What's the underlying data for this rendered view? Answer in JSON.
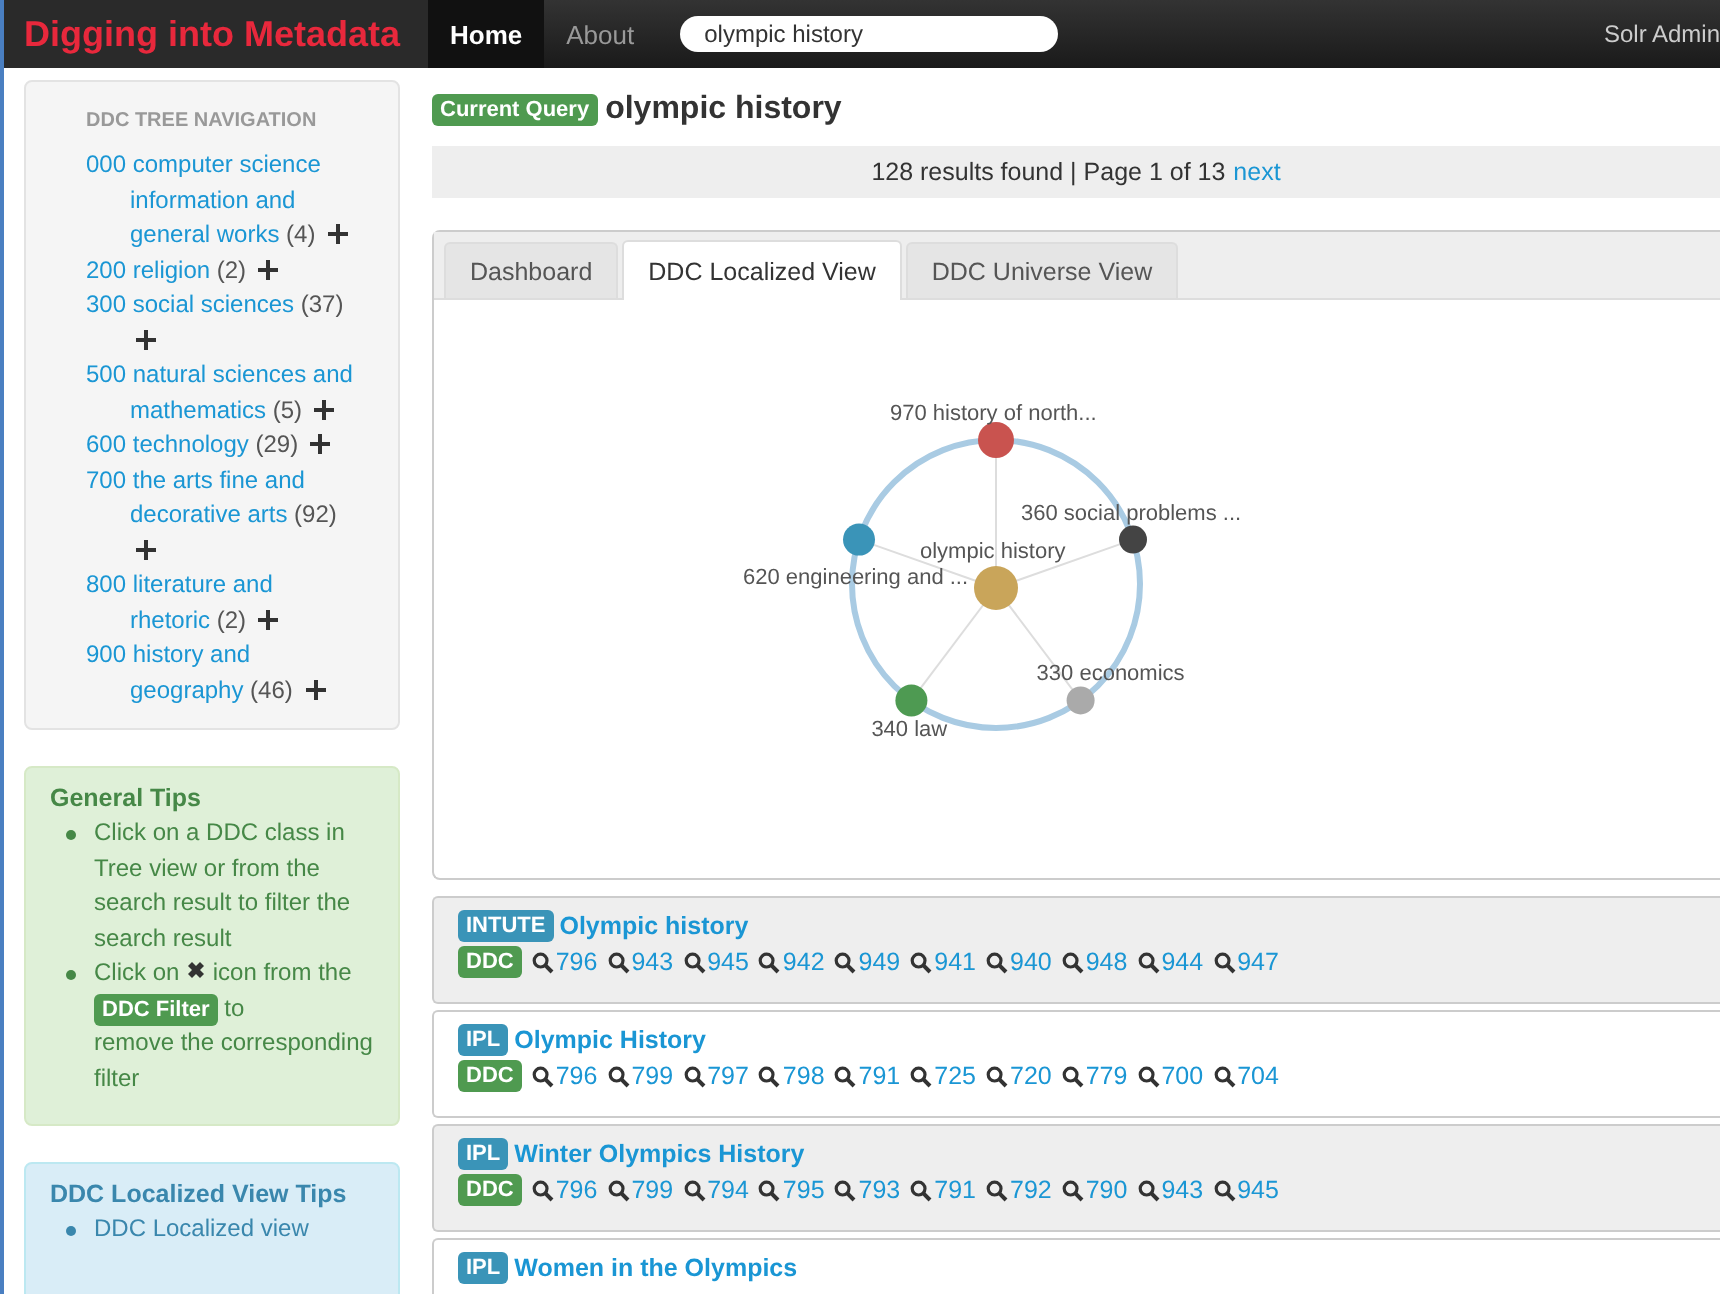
{
  "navbar": {
    "brand": "Digging into Metadata",
    "links": [
      {
        "label": "Home",
        "selected": true
      },
      {
        "label": "About",
        "selected": false
      }
    ],
    "search": {
      "value": "olympic history"
    },
    "admin": "Solr Admin"
  },
  "sidebar": {
    "tree": {
      "heading": "DDC TREE NAVIGATION",
      "items": [
        {
          "label": "000 computer science information and general works",
          "count": "(4)"
        },
        {
          "label": "200 religion",
          "count": "(2)"
        },
        {
          "label": "300 social sciences",
          "count": "(37)"
        },
        {
          "label": "500 natural sciences and mathematics",
          "count": "(5)"
        },
        {
          "label": "600 technology",
          "count": "(29)"
        },
        {
          "label": "700 the arts fine and decorative arts",
          "count": "(92)"
        },
        {
          "label": "800 literature and rhetoric",
          "count": "(2)"
        },
        {
          "label": "900 history and geography",
          "count": "(46)"
        }
      ]
    },
    "general_tips": {
      "title": "General Tips",
      "items": [
        {
          "kind": "text",
          "text": "Click on a DDC class in Tree view or from the search result to filter the search result"
        },
        {
          "kind": "filter",
          "before": "Click on",
          "after_icon": "icon from",
          "between": "the",
          "badge": "DDC Filter",
          "after_badge": "to",
          "tail": "remove the corresponding filter"
        }
      ]
    },
    "localized_tips": {
      "title": "DDC Localized View Tips",
      "items": [
        {
          "kind": "text",
          "text": "DDC Localized view"
        }
      ]
    }
  },
  "query": {
    "badge": "Current Query",
    "text": "olympic history"
  },
  "results_bar": {
    "summary": "128 results found | Page 1 of 13",
    "next": "next"
  },
  "tabs": [
    {
      "label": "Dashboard",
      "selected": false
    },
    {
      "label": "DDC Localized View",
      "selected": true
    },
    {
      "label": "DDC Universe View",
      "selected": false
    }
  ],
  "graph": {
    "center": {
      "label": "olympic history",
      "color": "#c9a55a"
    },
    "nodes": [
      {
        "label": "970 history of north...",
        "color": "#c9534f"
      },
      {
        "label": "360 social problems ...",
        "color": "#444444"
      },
      {
        "label": "620 engineering and ...",
        "color": "#3a94b8"
      },
      {
        "label": "330 economics",
        "color": "#aaaaaa"
      },
      {
        "label": "340 law",
        "color": "#4e9a52"
      }
    ]
  },
  "results": [
    {
      "source": "INTUTE",
      "title": "Olympic history",
      "ddc_badge": "DDC",
      "codes": [
        "796",
        "943",
        "945",
        "942",
        "949",
        "941",
        "940",
        "948",
        "944",
        "947"
      ]
    },
    {
      "source": "IPL",
      "title": "Olympic History",
      "ddc_badge": "DDC",
      "codes": [
        "796",
        "799",
        "797",
        "798",
        "791",
        "725",
        "720",
        "779",
        "700",
        "704"
      ]
    },
    {
      "source": "IPL",
      "title": "Winter Olympics History",
      "ddc_badge": "DDC",
      "codes": [
        "796",
        "799",
        "794",
        "795",
        "793",
        "791",
        "792",
        "790",
        "943",
        "945"
      ]
    },
    {
      "source": "IPL",
      "title": "Women in the Olympics"
    }
  ]
}
